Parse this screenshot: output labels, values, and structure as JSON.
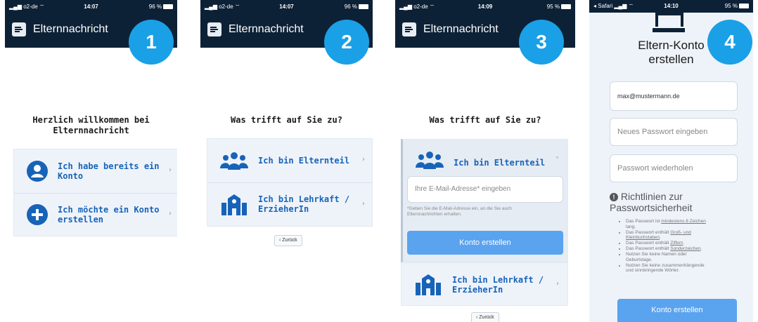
{
  "colors": {
    "navy": "#0d2136",
    "badge": "#1aa0e6",
    "accent": "#1763b8",
    "button": "#5aa3ef"
  },
  "screen1": {
    "status": {
      "carrier": "o2-de",
      "time": "14:07",
      "battery": "96 %"
    },
    "app_title": "Elternnachricht",
    "step": "1",
    "heading_line1": "Herzlich willkommen bei",
    "heading_line2": "Elternnachricht",
    "options": [
      {
        "line1": "Ich habe bereits ein",
        "line2": "Konto",
        "icon": "user-icon"
      },
      {
        "line1": "Ich möchte ein Konto",
        "line2": "erstellen",
        "icon": "plus-icon"
      }
    ]
  },
  "screen2": {
    "status": {
      "carrier": "o2-de",
      "time": "14:07",
      "battery": "96 %"
    },
    "app_title": "Elternnachricht",
    "step": "2",
    "heading": "Was trifft auf Sie zu?",
    "options": [
      {
        "line1": "Ich bin Elternteil",
        "line2": "",
        "icon": "family-icon"
      },
      {
        "line1": "Ich bin Lehrkaft /",
        "line2": "ErzieherIn",
        "icon": "school-icon"
      }
    ],
    "back_label": "‹ Zurück"
  },
  "screen3": {
    "status": {
      "carrier": "o2-de",
      "time": "14:09",
      "battery": "95 %"
    },
    "app_title": "Elternnachricht",
    "step": "3",
    "heading": "Was trifft auf Sie zu?",
    "parent_option": "Ich bin Elternteil",
    "email_placeholder": "Ihre E-Mail-Adresse* eingeben",
    "note_line1": "*Geben Sie die E-Mail-Adresse ein, an die Sie auch",
    "note_line2": "Elternnachrichten erhalten.",
    "create_button": "Konto erstellen",
    "teacher_line1": "Ich bin Lehrkaft /",
    "teacher_line2": "ErzieherIn",
    "back_label": "‹ Zurück"
  },
  "screen4": {
    "status": {
      "carrier": "Safari",
      "time": "14:10",
      "battery": "95 %"
    },
    "step": "4",
    "title_line1": "Eltern-Konto",
    "title_line2": "erstellen",
    "email_value": "max@mustermann.de",
    "password_placeholder": "Neues Passwort eingeben",
    "repeat_placeholder": "Passwort wiederholen",
    "rules_title_line1": "Richtlinien zur",
    "rules_title_line2": "Passwortsicherheit",
    "rules": {
      "r1_pre": "Das Passwort ist ",
      "r1_u": "mindestens 8 Zeichen",
      "r1_post": " lang.",
      "r2_pre": "Das Passwort enthält ",
      "r2_u": "Groß- und Kleinbuchstaben",
      "r2_post": ".",
      "r3_pre": "Das Passwort enthält ",
      "r3_u": "Ziffern",
      "r3_post": ".",
      "r4_pre": "Das Passwort enthält ",
      "r4_u": "Sonderzeichen",
      "r4_post": ".",
      "r5": "Nutzen Sie keine Namen oder Geburtstage.",
      "r6": "Nutzen Sie keine zusammenhängende und sinnbringende Wörter."
    },
    "create_button": "Konto erstellen"
  }
}
